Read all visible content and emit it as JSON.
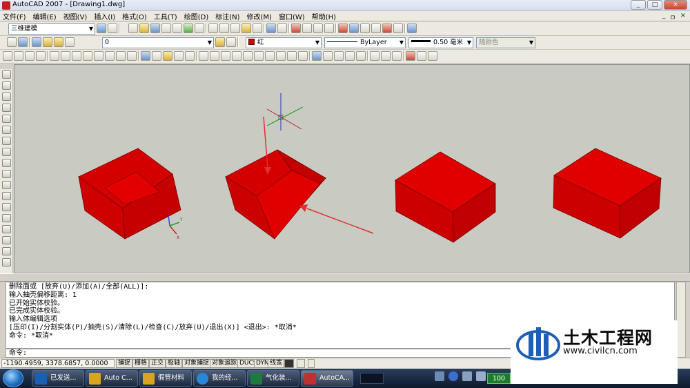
{
  "window": {
    "title": "AutoCAD 2007 - [Drawing1.dwg]",
    "controls": [
      "_",
      "□",
      "×"
    ],
    "mdi_controls": [
      "_",
      "ㅁ",
      "×"
    ]
  },
  "menu": [
    "文件(F)",
    "编辑(E)",
    "视图(V)",
    "插入(I)",
    "格式(O)",
    "工具(T)",
    "绘图(D)",
    "标注(N)",
    "修改(M)",
    "窗口(W)",
    "帮助(H)"
  ],
  "toolbar": {
    "workspace": "三维建模",
    "layer": "0",
    "color": "红",
    "linetype": "ByLayer",
    "lineweight": "0.50 毫米",
    "plotstyle": "随颜色"
  },
  "command_history": [
    "删除面或 [放弃(U)/添加(A)/全部(ALL)]:",
    "输入抽壳偏移距离: 1",
    "已开始实体校验。",
    "已完成实体校验。",
    "输入体编辑选项",
    "[压印(I)/分割实体(P)/抽壳(S)/清除(L)/检查(C)/放弃(U)/退出(X)] <退出>: *取消*",
    "命令: *取消*"
  ],
  "command_prompt": "命令:",
  "status": {
    "coords": "-1190.4959, 3378.6857, 0.0000",
    "toggles": [
      "捕捉",
      "栅格",
      "正交",
      "极轴",
      "对象捕捉",
      "对象追踪",
      "DUCS",
      "DYN",
      "线宽"
    ]
  },
  "taskbar": {
    "tasks": [
      {
        "label": "已发送...",
        "color": "#1b5fb5"
      },
      {
        "label": "Auto C...",
        "color": "#d9a520"
      },
      {
        "label": "假管材料",
        "color": "#d9a520"
      },
      {
        "label": "我的经...",
        "color": "#2a86d9"
      },
      {
        "label": "气化装...",
        "color": "#1e7a3e"
      },
      {
        "label": "AutoCA...",
        "color": "#c03030"
      }
    ],
    "network": "100"
  },
  "watermark": {
    "title": "土木工程网",
    "url": "www.civilcn.com"
  },
  "colors": {
    "solid": "#d40000",
    "viewport": "#c9cbc3"
  }
}
